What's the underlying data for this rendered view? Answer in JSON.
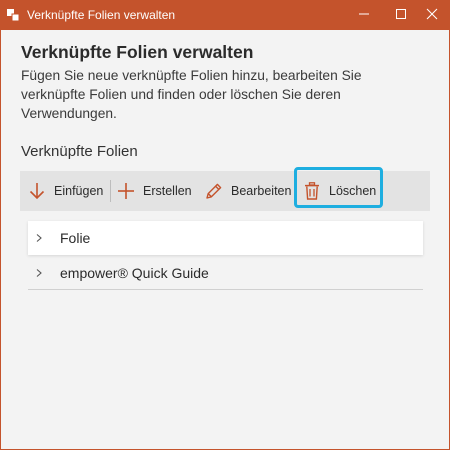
{
  "window": {
    "title": "Verknüpfte Folien verwalten"
  },
  "dialog": {
    "heading": "Verknüpfte Folien verwalten",
    "description": "Fügen Sie neue verknüpfte Folien hinzu, bearbeiten Sie verknüpfte Folien und finden oder löschen Sie deren Verwendungen.",
    "section_title": "Verknüpfte Folien"
  },
  "toolbar": {
    "insert_label": "Einfügen",
    "create_label": "Erstellen",
    "edit_label": "Bearbeiten",
    "delete_label": "Löschen"
  },
  "list": {
    "items": [
      {
        "label": "Folie"
      },
      {
        "label": "empower® Quick Guide"
      }
    ]
  },
  "colors": {
    "titlebar": "#c4532c",
    "accent_icon": "#c4532c",
    "highlight": "#1eaee0",
    "toolbar_bg": "#e3e3e3",
    "window_bg": "#f3f3f3"
  },
  "icons": {
    "app": "slides-app-icon",
    "minimize": "minimize-icon",
    "maximize": "maximize-icon",
    "close": "close-icon",
    "insert": "arrow-down-icon",
    "create": "plus-icon",
    "edit": "pencil-icon",
    "delete": "trash-icon",
    "expand": "chevron-right-icon"
  }
}
